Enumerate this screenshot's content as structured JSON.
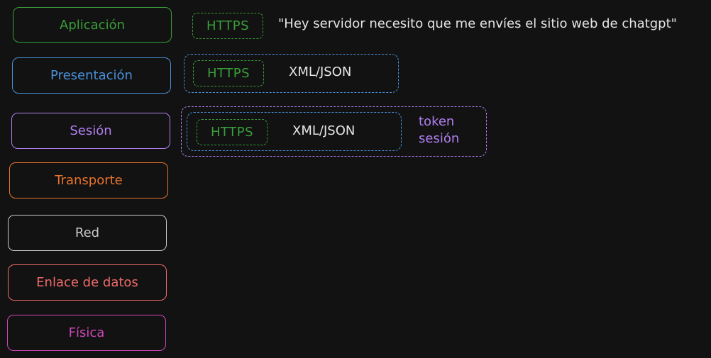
{
  "colors": {
    "background": "#121212",
    "aplicacion": "#3a9d3a",
    "presentacion": "#4a90d9",
    "sesion": "#b07ff0",
    "transporte": "#e8732c",
    "red": "#c8c8c8",
    "enlace": "#f06a6a",
    "fisica": "#cf47b8",
    "text_light": "#e6e6e6"
  },
  "layers": [
    {
      "label": "Aplicación",
      "color": "#3a9d3a"
    },
    {
      "label": "Presentación",
      "color": "#4a90d9"
    },
    {
      "label": "Sesión",
      "color": "#b07ff0"
    },
    {
      "label": "Transporte",
      "color": "#e8732c"
    },
    {
      "label": "Red",
      "color": "#c8c8c8"
    },
    {
      "label": "Enlace de datos",
      "color": "#f06a6a"
    },
    {
      "label": "Física",
      "color": "#cf47b8"
    }
  ],
  "row_aplicacion": {
    "protocol": "HTTPS",
    "message": "\"Hey servidor necesito que me envíes el sitio web de chatgpt\""
  },
  "row_presentacion": {
    "protocol": "HTTPS",
    "format": "XML/JSON"
  },
  "row_sesion": {
    "protocol": "HTTPS",
    "format": "XML/JSON",
    "token_line1": "token",
    "token_line2": "sesión"
  }
}
